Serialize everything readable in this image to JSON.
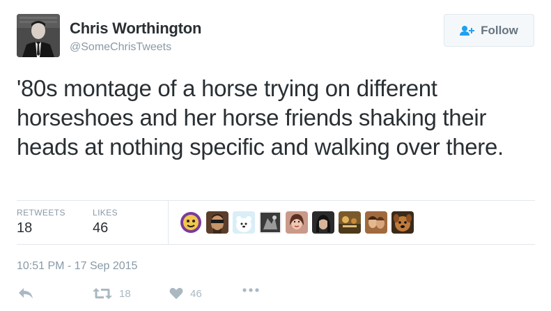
{
  "user": {
    "name": "Chris Worthington",
    "handle": "@SomeChrisTweets"
  },
  "follow_button": {
    "label": "Follow",
    "icon": "follow-user-plus-icon"
  },
  "tweet": {
    "text": "'80s montage of a horse trying on different horseshoes and her horse friends shaking their heads at nothing specific and walking over there.",
    "timestamp": "10:51 PM - 17 Sep 2015"
  },
  "stats": {
    "retweets_label": "RETWEETS",
    "retweets_count": "18",
    "likes_label": "LIKES",
    "likes_count": "46"
  },
  "actions": {
    "reply_icon": "reply-icon",
    "retweet_icon": "retweet-icon",
    "retweet_count": "18",
    "like_icon": "heart-icon",
    "like_count": "46",
    "more_icon": "more-dots-icon"
  },
  "colors": {
    "text": "#292f33",
    "secondary": "#8899a6",
    "icon_gray": "#aab8c2",
    "follow_blue": "#1da1f2",
    "border": "#e1e8ed"
  }
}
